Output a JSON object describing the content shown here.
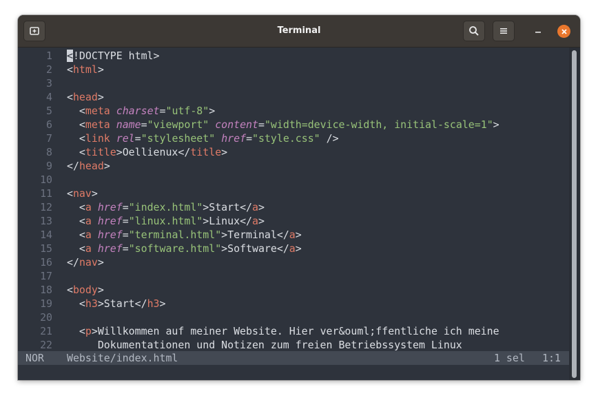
{
  "window": {
    "title": "Terminal"
  },
  "icons": {
    "new_tab": "new-tab-icon",
    "search": "search-icon",
    "menu": "hamburger-menu-icon",
    "minimize": "minimize-icon",
    "close": "close-icon"
  },
  "colors": {
    "titlebar": "#3c3834",
    "editor_bg": "#2e333c",
    "tag": "#e07b67",
    "attribute": "#c583c0",
    "string": "#98c379",
    "close_button": "#e9772d"
  },
  "editor": {
    "lines": [
      {
        "n": "1",
        "t": [
          [
            "cursor",
            "<"
          ],
          [
            "plain",
            "!DOCTYPE html>"
          ]
        ]
      },
      {
        "n": "2",
        "t": [
          [
            "plain",
            "<"
          ],
          [
            "tag",
            "html"
          ],
          [
            "plain",
            ">"
          ]
        ]
      },
      {
        "n": "3",
        "t": []
      },
      {
        "n": "4",
        "t": [
          [
            "plain",
            "<"
          ],
          [
            "tag",
            "head"
          ],
          [
            "plain",
            ">"
          ]
        ]
      },
      {
        "n": "5",
        "t": [
          [
            "plain",
            "  <"
          ],
          [
            "tag",
            "meta"
          ],
          [
            "plain",
            " "
          ],
          [
            "attr",
            "charset"
          ],
          [
            "plain",
            "="
          ],
          [
            "str",
            "\"utf-8\""
          ],
          [
            "plain",
            ">"
          ]
        ]
      },
      {
        "n": "6",
        "t": [
          [
            "plain",
            "  <"
          ],
          [
            "tag",
            "meta"
          ],
          [
            "plain",
            " "
          ],
          [
            "attr",
            "name"
          ],
          [
            "plain",
            "="
          ],
          [
            "str",
            "\"viewport\""
          ],
          [
            "plain",
            " "
          ],
          [
            "attr",
            "content"
          ],
          [
            "plain",
            "="
          ],
          [
            "str",
            "\"width=device-width, initial-scale=1\""
          ],
          [
            "plain",
            ">"
          ]
        ]
      },
      {
        "n": "7",
        "t": [
          [
            "plain",
            "  <"
          ],
          [
            "tag",
            "link"
          ],
          [
            "plain",
            " "
          ],
          [
            "attr",
            "rel"
          ],
          [
            "plain",
            "="
          ],
          [
            "str",
            "\"stylesheet\""
          ],
          [
            "plain",
            " "
          ],
          [
            "attr",
            "href"
          ],
          [
            "plain",
            "="
          ],
          [
            "str",
            "\"style.css\""
          ],
          [
            "plain",
            " />"
          ]
        ]
      },
      {
        "n": "8",
        "t": [
          [
            "plain",
            "  <"
          ],
          [
            "tag",
            "title"
          ],
          [
            "plain",
            ">Oellienux</"
          ],
          [
            "tag",
            "title"
          ],
          [
            "plain",
            ">"
          ]
        ]
      },
      {
        "n": "9",
        "t": [
          [
            "plain",
            "</"
          ],
          [
            "tag",
            "head"
          ],
          [
            "plain",
            ">"
          ]
        ]
      },
      {
        "n": "10",
        "t": []
      },
      {
        "n": "11",
        "t": [
          [
            "plain",
            "<"
          ],
          [
            "tag",
            "nav"
          ],
          [
            "plain",
            ">"
          ]
        ]
      },
      {
        "n": "12",
        "t": [
          [
            "plain",
            "  <"
          ],
          [
            "tag",
            "a"
          ],
          [
            "plain",
            " "
          ],
          [
            "attr",
            "href"
          ],
          [
            "plain",
            "="
          ],
          [
            "str",
            "\"index.html\""
          ],
          [
            "plain",
            ">Start</"
          ],
          [
            "tag",
            "a"
          ],
          [
            "plain",
            ">"
          ]
        ]
      },
      {
        "n": "13",
        "t": [
          [
            "plain",
            "  <"
          ],
          [
            "tag",
            "a"
          ],
          [
            "plain",
            " "
          ],
          [
            "attr",
            "href"
          ],
          [
            "plain",
            "="
          ],
          [
            "str",
            "\"linux.html\""
          ],
          [
            "plain",
            ">Linux</"
          ],
          [
            "tag",
            "a"
          ],
          [
            "plain",
            ">"
          ]
        ]
      },
      {
        "n": "14",
        "t": [
          [
            "plain",
            "  <"
          ],
          [
            "tag",
            "a"
          ],
          [
            "plain",
            " "
          ],
          [
            "attr",
            "href"
          ],
          [
            "plain",
            "="
          ],
          [
            "str",
            "\"terminal.html\""
          ],
          [
            "plain",
            ">Terminal</"
          ],
          [
            "tag",
            "a"
          ],
          [
            "plain",
            ">"
          ]
        ]
      },
      {
        "n": "15",
        "t": [
          [
            "plain",
            "  <"
          ],
          [
            "tag",
            "a"
          ],
          [
            "plain",
            " "
          ],
          [
            "attr",
            "href"
          ],
          [
            "plain",
            "="
          ],
          [
            "str",
            "\"software.html\""
          ],
          [
            "plain",
            ">Software</"
          ],
          [
            "tag",
            "a"
          ],
          [
            "plain",
            ">"
          ]
        ]
      },
      {
        "n": "16",
        "t": [
          [
            "plain",
            "</"
          ],
          [
            "tag",
            "nav"
          ],
          [
            "plain",
            ">"
          ]
        ]
      },
      {
        "n": "17",
        "t": []
      },
      {
        "n": "18",
        "t": [
          [
            "plain",
            "<"
          ],
          [
            "tag",
            "body"
          ],
          [
            "plain",
            ">"
          ]
        ]
      },
      {
        "n": "19",
        "t": [
          [
            "plain",
            "  <"
          ],
          [
            "tag",
            "h3"
          ],
          [
            "plain",
            ">Start</"
          ],
          [
            "tag",
            "h3"
          ],
          [
            "plain",
            ">"
          ]
        ]
      },
      {
        "n": "20",
        "t": []
      },
      {
        "n": "21",
        "t": [
          [
            "plain",
            "  <"
          ],
          [
            "tag",
            "p"
          ],
          [
            "plain",
            ">Willkommen auf meiner Website. Hier ver&ouml;ffentliche ich meine"
          ]
        ]
      },
      {
        "n": "22",
        "t": [
          [
            "plain",
            "     Dokumentationen und Notizen zum freien Betriebssystem Linux"
          ]
        ]
      }
    ]
  },
  "statusbar": {
    "mode": "NOR",
    "file": "Website/index.html",
    "selection": "1 sel",
    "position": "1:1"
  }
}
